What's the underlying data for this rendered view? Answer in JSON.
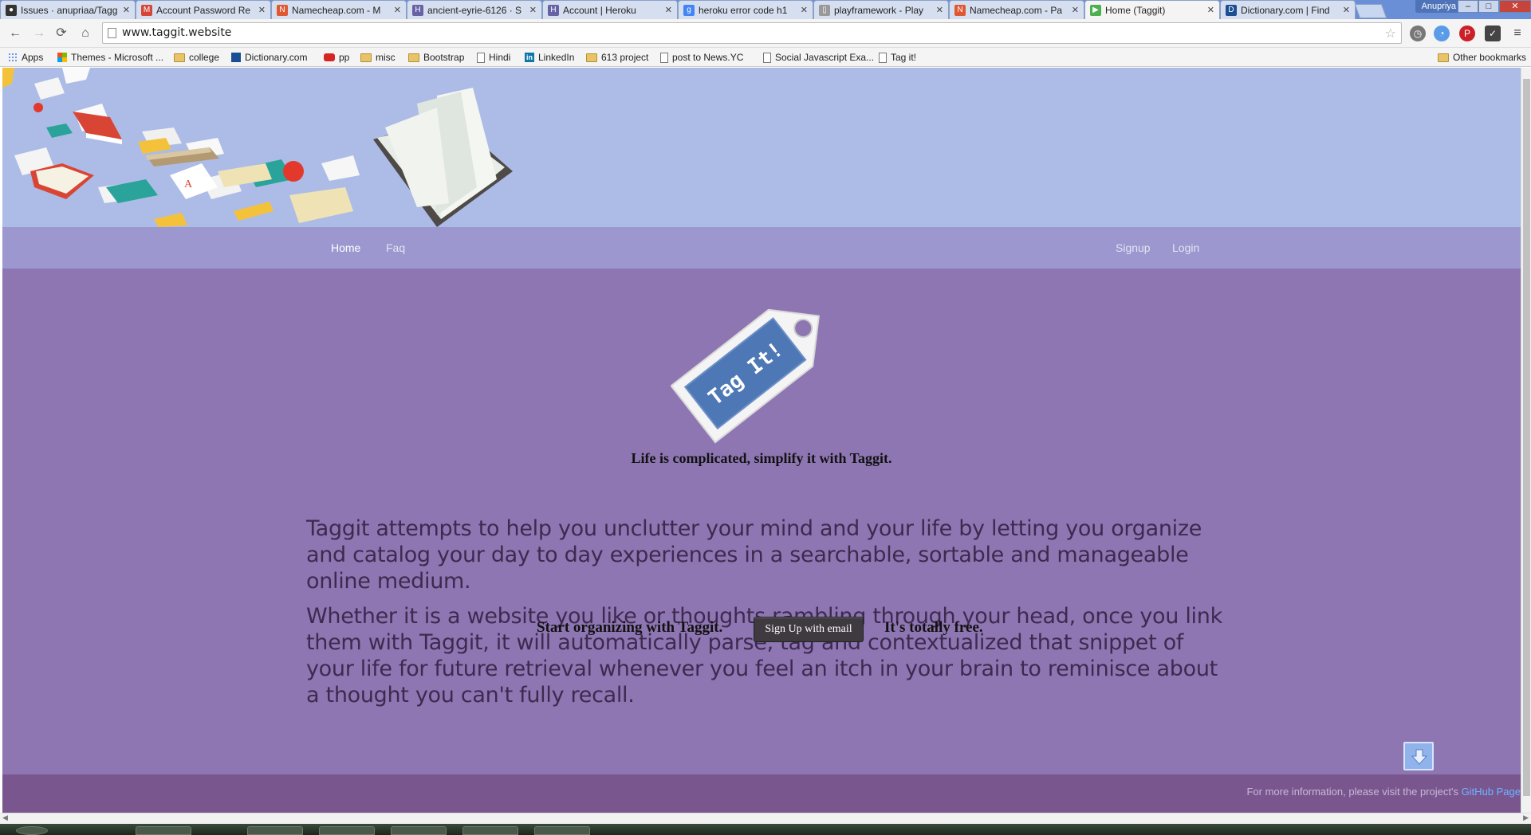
{
  "browser": {
    "tabs": [
      {
        "label": "Issues · anupriaa/Tagg",
        "icon": "github-icon",
        "color": "#333333"
      },
      {
        "label": "Account Password Re",
        "icon": "gmail-icon",
        "color": "#d44638"
      },
      {
        "label": "Namecheap.com - M",
        "icon": "namecheap-icon",
        "color": "#de5833"
      },
      {
        "label": "ancient-eyrie-6126 · S",
        "icon": "heroku-icon",
        "color": "#6762a6"
      },
      {
        "label": "Account | Heroku",
        "icon": "heroku-icon",
        "color": "#6762a6"
      },
      {
        "label": "heroku error code h1",
        "icon": "google-icon",
        "color": "#4285f4"
      },
      {
        "label": "playframework - Play",
        "icon": "document-icon",
        "color": "#999999"
      },
      {
        "label": "Namecheap.com - Pa",
        "icon": "namecheap-icon",
        "color": "#de5833"
      },
      {
        "label": "Home (Taggit)",
        "icon": "play-icon",
        "color": "#4caf50",
        "active": true
      },
      {
        "label": "Dictionary.com | Find",
        "icon": "dictionary-icon",
        "color": "#1b4e92"
      }
    ],
    "user": "Anupriya",
    "url": "www.taggit.website",
    "bookmarks": [
      {
        "label": "Apps",
        "icon": "apps"
      },
      {
        "label": "Themes - Microsoft ...",
        "icon": "ms"
      },
      {
        "label": "college",
        "icon": "folder"
      },
      {
        "label": "Dictionary.com",
        "icon": "dict"
      },
      {
        "label": "pp",
        "icon": "yt"
      },
      {
        "label": "misc",
        "icon": "folder"
      },
      {
        "label": "Bootstrap",
        "icon": "folder"
      },
      {
        "label": "Hindi",
        "icon": "page"
      },
      {
        "label": "LinkedIn",
        "icon": "li"
      },
      {
        "label": "613 project",
        "icon": "folder"
      },
      {
        "label": "post to News.YC",
        "icon": "page"
      },
      {
        "label": "Social Javascript Exa...",
        "icon": "page"
      },
      {
        "label": "Tag it!",
        "icon": "page"
      }
    ],
    "other_bookmarks": "Other bookmarks"
  },
  "site": {
    "nav": {
      "home": "Home",
      "faq": "Faq",
      "signup": "Signup",
      "login": "Login"
    },
    "logo_text": "Tag It!",
    "tagline": "Life is complicated, simplify it with Taggit.",
    "paragraph1": "Taggit attempts to help you unclutter your mind and your life by letting you organize and catalog your day to day experiences in a searchable, sortable and manageable online medium.",
    "paragraph2": "Whether it is a website you like or thoughts rambling through your head, once you link them with Taggit, it will automatically parse, tag and contextualized that snippet of your life for future retrieval whenever you feel an itch in your brain to reminisce about a thought you can't fully recall.",
    "cta_left": "Start organizing with Taggit.",
    "cta_button": "Sign Up with email",
    "cta_right": "It's totally free.",
    "footer_prefix": "For more information, please visit the project's ",
    "footer_link": "GitHub Page"
  },
  "colors": {
    "hero": "#adbce6",
    "nav": "#9c97cf",
    "main": "#8e76b2",
    "footer": "#7a568f",
    "link": "#6db4ff"
  }
}
